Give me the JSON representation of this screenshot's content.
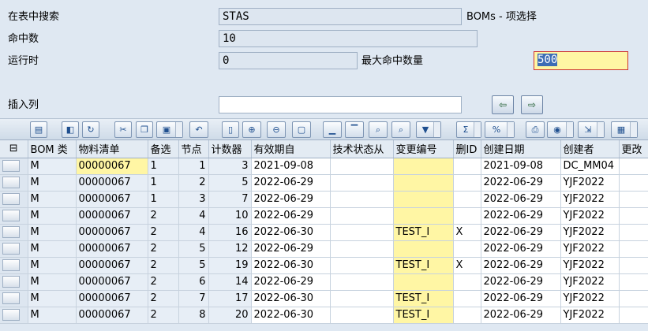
{
  "form": {
    "search_label": "在表中搜索",
    "search_value": "STAS",
    "table_caption": "BOMs - 项选择",
    "hits_label": "命中数",
    "hits_value": "10",
    "runtime_label": "运行时",
    "runtime_value": "0",
    "max_hits_label": "最大命中数量",
    "max_hits_value": "500",
    "insert_col_label": "插入列",
    "insert_col_value": ""
  },
  "top_buttons": [
    {
      "name": "copy-columns-icon",
      "glyph": "⇦"
    },
    {
      "name": "paste-columns-icon",
      "glyph": "⇨"
    }
  ],
  "toolbar_icons": [
    "details-icon",
    "check-table-icon",
    "refresh-icon",
    "cut-icon",
    "copy-icon",
    "paste-icon",
    "undo-icon",
    "new-row-icon",
    "insert-row-icon",
    "delete-row-icon",
    "copy-row-icon",
    "sort-asc-icon",
    "sort-desc-icon",
    "find-icon",
    "find-next-icon",
    "filter-icon",
    "sum-icon",
    "subtotal-icon",
    "print-icon",
    "views-icon",
    "export-icon",
    "layout-icon"
  ],
  "columns": [
    "BOM 类",
    "物料清单",
    "备选",
    "节点",
    "计数器",
    "有效期自",
    "技术状态从",
    "变更编号",
    "删ID",
    "创建日期",
    "创建者",
    "更改"
  ],
  "rows": [
    [
      "M",
      "00000067",
      "1",
      "1",
      "3",
      "2021-09-08",
      "",
      "",
      "",
      "2021-09-08",
      "DC_MM04",
      ""
    ],
    [
      "M",
      "00000067",
      "1",
      "2",
      "5",
      "2022-06-29",
      "",
      "",
      "",
      "2022-06-29",
      "YJF2022",
      ""
    ],
    [
      "M",
      "00000067",
      "1",
      "3",
      "7",
      "2022-06-29",
      "",
      "",
      "",
      "2022-06-29",
      "YJF2022",
      ""
    ],
    [
      "M",
      "00000067",
      "2",
      "4",
      "10",
      "2022-06-29",
      "",
      "",
      "",
      "2022-06-29",
      "YJF2022",
      ""
    ],
    [
      "M",
      "00000067",
      "2",
      "4",
      "16",
      "2022-06-30",
      "",
      "TEST_I",
      "X",
      "2022-06-29",
      "YJF2022",
      ""
    ],
    [
      "M",
      "00000067",
      "2",
      "5",
      "12",
      "2022-06-29",
      "",
      "",
      "",
      "2022-06-29",
      "YJF2022",
      ""
    ],
    [
      "M",
      "00000067",
      "2",
      "5",
      "19",
      "2022-06-30",
      "",
      "TEST_I",
      "X",
      "2022-06-29",
      "YJF2022",
      ""
    ],
    [
      "M",
      "00000067",
      "2",
      "6",
      "14",
      "2022-06-29",
      "",
      "",
      "",
      "2022-06-29",
      "YJF2022",
      ""
    ],
    [
      "M",
      "00000067",
      "2",
      "7",
      "17",
      "2022-06-30",
      "",
      "TEST_I",
      "",
      "2022-06-29",
      "YJF2022",
      ""
    ],
    [
      "M",
      "00000067",
      "2",
      "8",
      "20",
      "2022-06-30",
      "",
      "TEST_I",
      "",
      "2022-06-29",
      "YJF2022",
      ""
    ]
  ],
  "colors": {
    "accent": "#3d6db5",
    "input_highlight": "#fff6a4",
    "background": "#dfe8f2"
  }
}
